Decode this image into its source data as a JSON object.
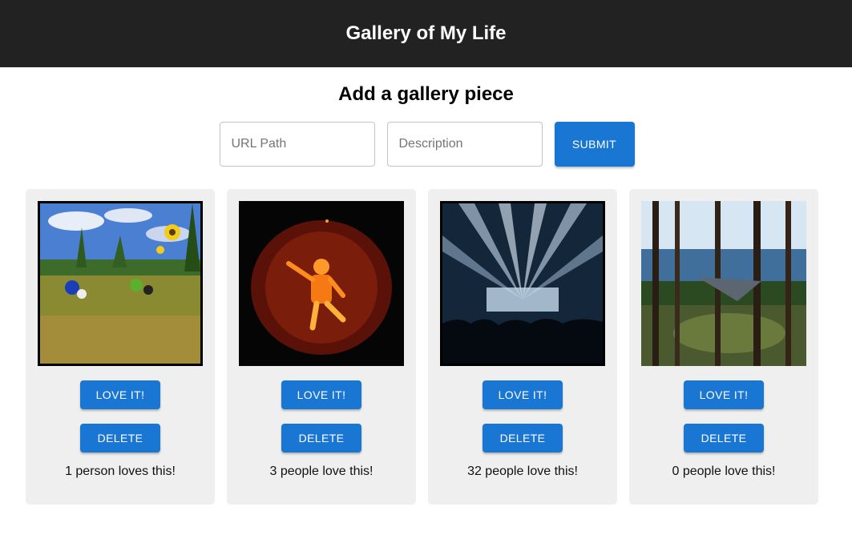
{
  "header": {
    "title": "Gallery of My Life"
  },
  "form": {
    "heading": "Add a gallery piece",
    "url_placeholder": "URL Path",
    "description_placeholder": "Description",
    "submit_label": "SUBMIT"
  },
  "gallery": {
    "items": [
      {
        "subject": "dirt bikes in a meadow with sunflowers",
        "love_label": "LOVE IT!",
        "delete_label": "DELETE",
        "loves_text": "1 person loves this!"
      },
      {
        "subject": "carved jack-o'-lantern football player",
        "love_label": "LOVE IT!",
        "delete_label": "DELETE",
        "loves_text": "3 people love this!"
      },
      {
        "subject": "concert stage with light beams",
        "love_label": "LOVE IT!",
        "delete_label": "DELETE",
        "loves_text": "32 people love this!"
      },
      {
        "subject": "hammock among pine trees by a lake",
        "love_label": "LOVE IT!",
        "delete_label": "DELETE",
        "loves_text": "0 people love this!"
      }
    ]
  },
  "colors": {
    "header_bg": "#222222",
    "primary": "#1976d2",
    "card_bg": "#efefef"
  }
}
